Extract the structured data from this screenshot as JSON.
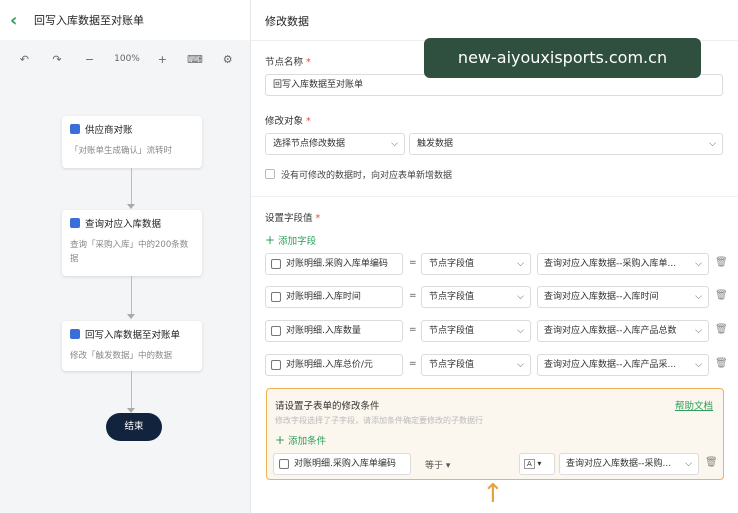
{
  "flow": {
    "title": "回写入库数据至对账单",
    "back_icon": "chevron-left-icon",
    "zoom": "100%"
  },
  "nodes": [
    {
      "title": "供应商对账",
      "desc": "「对账单生成确认」流转时"
    },
    {
      "title": "查询对应入库数据",
      "desc": "查询「采购入库」中的200条数据"
    },
    {
      "title": "回写入库数据至对账单",
      "desc": "修改「触发数据」中的数据"
    }
  ],
  "end_label": "结束",
  "panel": {
    "title": "修改数据",
    "watermark": "new-aiyouxisports.com.cn",
    "node_name_label": "节点名称",
    "required_mark": "*",
    "node_name_value": "回写入库数据至对账单",
    "target_label": "修改对象",
    "target_select1": "选择节点修改数据",
    "target_select2": "触发数据",
    "checkbox_label": "没有可修改的数据时，向对应表单新增数据",
    "set_values_label": "设置字段值",
    "add_field": "添加字段",
    "equals": "=",
    "fields": [
      {
        "field": "对账明细.采购入库单编码",
        "type": "节点字段值",
        "value": "查询对应入库数据--采购入库单..."
      },
      {
        "field": "对账明细.入库时间",
        "type": "节点字段值",
        "value": "查询对应入库数据--入库时间"
      },
      {
        "field": "对账明细.入库数量",
        "type": "节点字段值",
        "value": "查询对应入库数据--入库产品总数"
      },
      {
        "field": "对账明细.入库总价/元",
        "type": "节点字段值",
        "value": "查询对应入库数据--入库产品采..."
      }
    ],
    "condition": {
      "title": "请设置子表单的修改条件",
      "help": "帮助文档",
      "hint": "修改字段选择了子字段，请添加条件确定要修改的子数据行",
      "add": "添加条件",
      "field": "对账明细.采购入库单编码",
      "operator": "等于",
      "mode": "A",
      "value": "查询对应入库数据--采购..."
    }
  },
  "colors": {
    "accent": "#2e9e5b",
    "highlight": "#f0b354",
    "end_node": "#12233d"
  }
}
